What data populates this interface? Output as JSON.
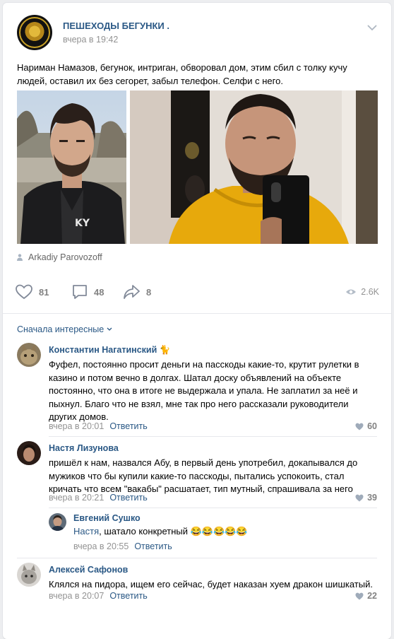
{
  "post": {
    "group_name": "ПЕШЕХОДЫ БЕГУНКИ .",
    "time": "вчера в 19:42",
    "text": "Нариман Намазов, бегунок, интриган, обворовал дом, этим сбил с толку кучу людей, оставил их без сегорет, забыл телефон. Селфи с него.",
    "author": "Arkadiy Parovozoff",
    "likes": "81",
    "comments": "48",
    "shares": "8",
    "views": "2.6K"
  },
  "sort_label": "Сначала интересные",
  "comments": [
    {
      "name": "Константин Нагатинский",
      "emoji": "🐈",
      "text": "Фуфел, постоянно просит деньги на пасскоды какие-то, крутит рулетки в казино и потом вечно в долгах. Шатал доску объявлений на объекте постоянно, что она в итоге не выдержала и упала. Не заплатил за неё и пыхнул. Благо что не взял, мне так про него рассказали руководители других домов.",
      "time": "вчера в 20:01",
      "reply_label": "Ответить",
      "likes": "60"
    },
    {
      "name": "Настя Лизунова",
      "text": "пришёл к нам, назвался Абу, в первый день употребил, докапывался до мужиков что бы купили какие-то пасскоды, пытались успокоить, стал кричать что всем \"вакабы\" расшатает, тип мутный, спрашивала за него",
      "time": "вчера в 20:21",
      "reply_label": "Ответить",
      "likes": "39"
    },
    {
      "name": "Алексей Сафонов",
      "text": "Клялся на пидора, ищем его сейчас, будет наказан хуем дракон шишкатый.",
      "time": "вчера в 20:07",
      "reply_label": "Ответить",
      "likes": "22"
    }
  ],
  "reply": {
    "name": "Евгений Сушко",
    "addressee": "Настя",
    "text": ", шатало конкретный 😂😂😂😂😂",
    "time": "вчера в 20:55",
    "reply_label": "Ответить"
  },
  "colors": {
    "link": "#2a5885",
    "meta": "#939393",
    "icon": "#828282",
    "background": "#edeef0",
    "hoodie": "#e7a90c"
  }
}
